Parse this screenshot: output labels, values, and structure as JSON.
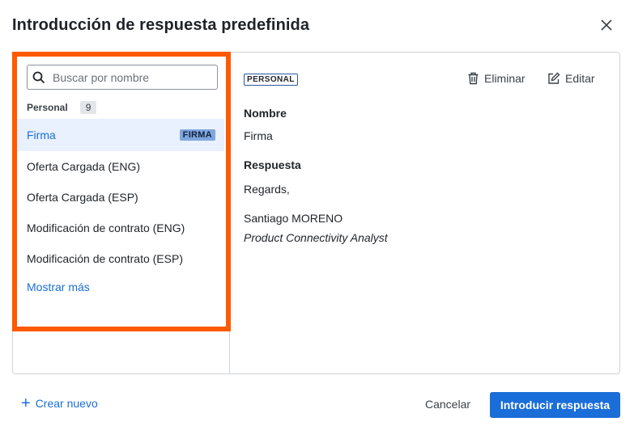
{
  "dialog": {
    "title": "Introducción de respuesta predefinida",
    "close_icon": "close-icon"
  },
  "sidebar": {
    "search_placeholder": "Buscar por nombre",
    "group": {
      "label": "Personal",
      "count": "9"
    },
    "items": [
      {
        "label": "Firma",
        "tag": "FIRMA",
        "selected": true
      },
      {
        "label": "Oferta Cargada (ENG)"
      },
      {
        "label": "Oferta Cargada (ESP)"
      },
      {
        "label": "Modificación de contrato (ENG)"
      },
      {
        "label": "Modificación de contrato (ESP)"
      }
    ],
    "show_more": "Mostrar más"
  },
  "detail": {
    "badge": "PERSONAL",
    "delete_label": "Eliminar",
    "edit_label": "Editar",
    "name_label": "Nombre",
    "name_value": "Firma",
    "response_label": "Respuesta",
    "response_line1": "Regards,",
    "response_line2": "Santiago MORENO",
    "response_line3": "Product Connectivity Analyst"
  },
  "footer": {
    "create_new": "Crear nuevo",
    "cancel": "Cancelar",
    "submit": "Introducir respuesta"
  },
  "colors": {
    "accent": "#1a6ed8",
    "highlight": "#ff5a00",
    "selected_bg": "#e8f1fd"
  }
}
